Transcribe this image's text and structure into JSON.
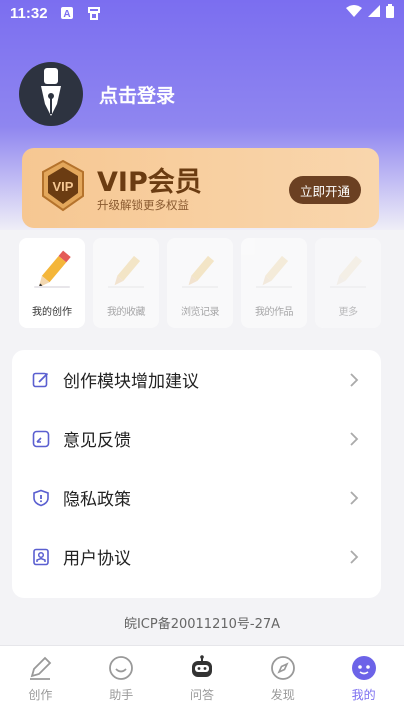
{
  "status_bar": {
    "time": "11:32",
    "icons": [
      "a-box-icon",
      "app-notification-icon",
      "wifi-icon",
      "signal-icon",
      "battery-icon"
    ]
  },
  "profile": {
    "login_label": "点击登录",
    "avatar_icon": "pen-nib-icon"
  },
  "vip": {
    "badge_text": "VIP",
    "title": "VIP会员",
    "subtitle": "升级解锁更多权益",
    "button_label": "立即开通",
    "colors": {
      "card": "#f7cc9a",
      "button": "#6b4022",
      "title": "#6b3c12"
    }
  },
  "quick_items": [
    {
      "label": "我的创作",
      "icon": "pencil-icon"
    },
    {
      "label": "我的收藏",
      "icon": "pencil-icon"
    },
    {
      "label": "浏览记录",
      "icon": "pencil-icon"
    },
    {
      "label": "我的作品",
      "icon": "pencil-icon"
    },
    {
      "label": "更多",
      "icon": "pencil-icon"
    }
  ],
  "menu": [
    {
      "label": "创作模块增加建议",
      "icon": "edit-square-icon"
    },
    {
      "label": "意见反馈",
      "icon": "feedback-icon"
    },
    {
      "label": "隐私政策",
      "icon": "shield-icon"
    },
    {
      "label": "用户协议",
      "icon": "user-doc-icon"
    }
  ],
  "icp": "皖ICP备20011210号-27A",
  "nav": [
    {
      "label": "创作",
      "icon": "pen-icon"
    },
    {
      "label": "助手",
      "icon": "smile-icon"
    },
    {
      "label": "问答",
      "icon": "robot-icon"
    },
    {
      "label": "发现",
      "icon": "compass-icon"
    },
    {
      "label": "我的",
      "icon": "user-face-icon"
    }
  ],
  "accent_color": "#7b6ef0"
}
